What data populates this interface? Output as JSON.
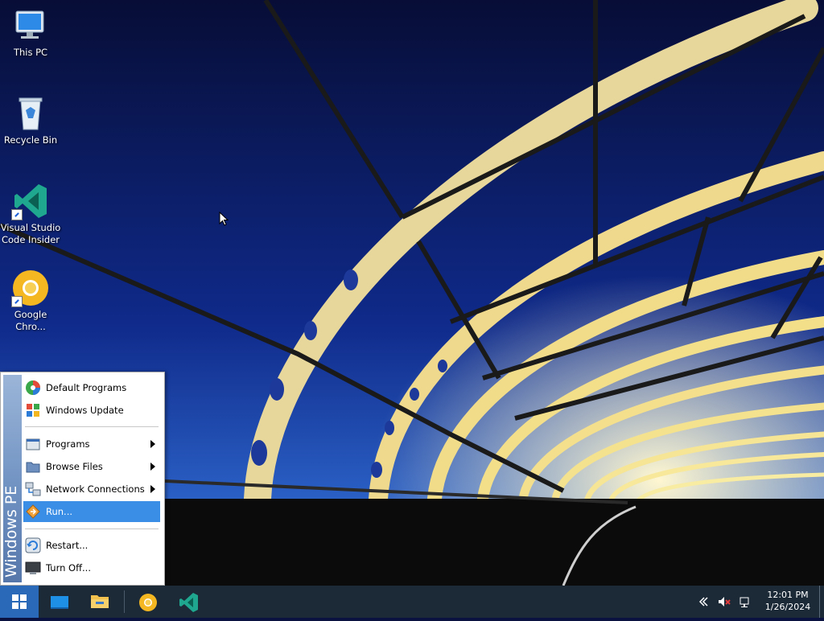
{
  "desktop": {
    "icons": [
      {
        "label": "This PC",
        "icon": "computer-icon"
      },
      {
        "label": "Recycle Bin",
        "icon": "recycle-bin-icon"
      },
      {
        "label": "Visual Studio Code Insider",
        "icon": "vscode-insiders-icon"
      },
      {
        "label": "Google Chro...",
        "icon": "chrome-icon"
      }
    ]
  },
  "start_menu": {
    "brand": "Windows PE",
    "items": [
      {
        "label": "Default Programs",
        "icon": "default-programs-icon"
      },
      {
        "label": "Windows Update",
        "icon": "windows-update-icon"
      },
      {
        "label": "Programs",
        "icon": "programs-icon",
        "submenu": true
      },
      {
        "label": "Browse Files",
        "icon": "folder-icon",
        "submenu": true
      },
      {
        "label": "Network Connections",
        "icon": "network-icon",
        "submenu": true
      },
      {
        "label": "Run...",
        "icon": "run-icon",
        "selected": true
      },
      {
        "label": "Restart...",
        "icon": "restart-icon"
      },
      {
        "label": "Turn Off...",
        "icon": "shutdown-icon"
      }
    ]
  },
  "taskbar": {
    "pinned": [
      "desktop-monitor-icon",
      "file-explorer-icon",
      "chrome-icon",
      "vscode-insiders-icon"
    ],
    "clock": {
      "time": "12:01 PM",
      "date": "1/26/2024"
    }
  },
  "colors": {
    "taskbar": "#1c2a38",
    "start_button": "#2a68b8",
    "menu_highlight": "#3a8ee6"
  }
}
